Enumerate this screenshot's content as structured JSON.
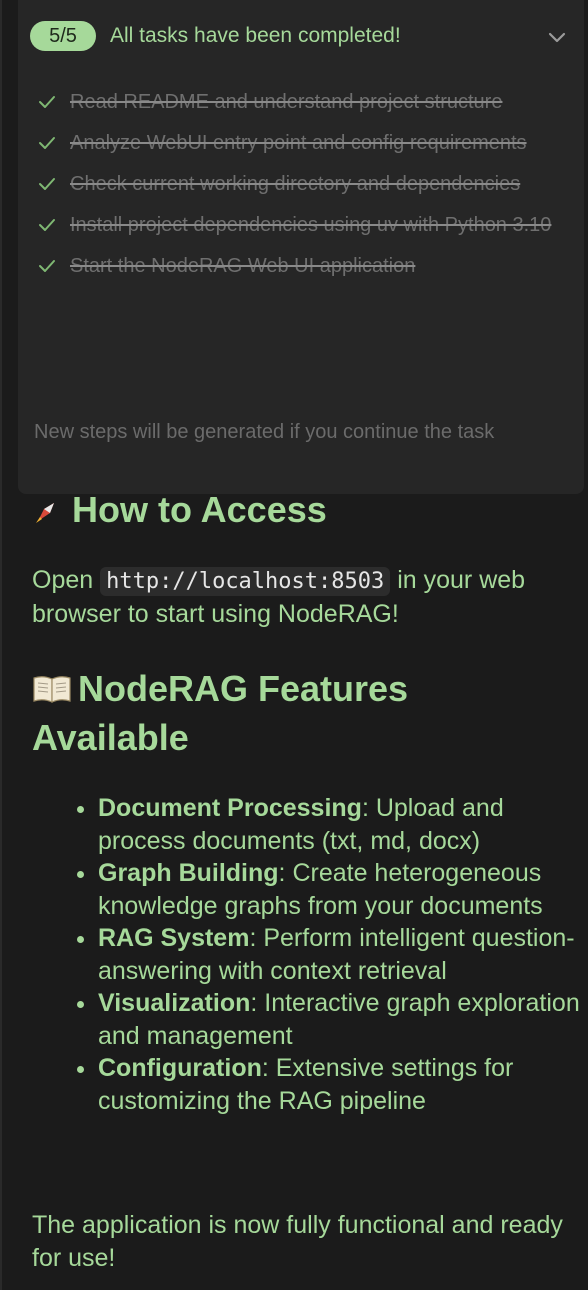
{
  "todo": {
    "progress": "5/5",
    "completed": 5,
    "total": 5,
    "title": "All tasks have been completed!",
    "items": [
      {
        "text": "Read README and understand project structure",
        "done": true
      },
      {
        "text": "Analyze WebUI entry point and config requirements",
        "done": true
      },
      {
        "text": "Check current working directory and dependencies",
        "done": true
      },
      {
        "text": "Install project dependencies using uv with Python 3.10",
        "done": true
      },
      {
        "text": "Start the NodeRAG Web UI application",
        "done": true
      }
    ],
    "footer": "New steps will be generated if you continue the task"
  },
  "access": {
    "heading": "How to Access",
    "text_before": "Open ",
    "url": "http://localhost:8503",
    "text_after": " in your web browser to start using NodeRAG!"
  },
  "features": {
    "heading": "NodeRAG Features Available",
    "items": [
      {
        "name": "Document Processing",
        "desc": ": Upload and process documents (txt, md, docx)"
      },
      {
        "name": "Graph Building",
        "desc": ": Create heterogeneous knowledge graphs from your documents"
      },
      {
        "name": "RAG System",
        "desc": ": Perform intelligent question-answering with context retrieval"
      },
      {
        "name": "Visualization",
        "desc": ": Interactive graph exploration and management"
      },
      {
        "name": "Configuration",
        "desc": ": Extensive settings for customizing the RAG pipeline"
      }
    ]
  },
  "closing": "The application is now fully functional and ready for use!",
  "colors": {
    "accent": "#a6d99a",
    "background": "#1b1b1b",
    "panel": "#262626",
    "muted": "#6f6f6f"
  },
  "icons": [
    "chevron-down-icon",
    "check-icon",
    "rocket-icon",
    "open-book-icon"
  ]
}
